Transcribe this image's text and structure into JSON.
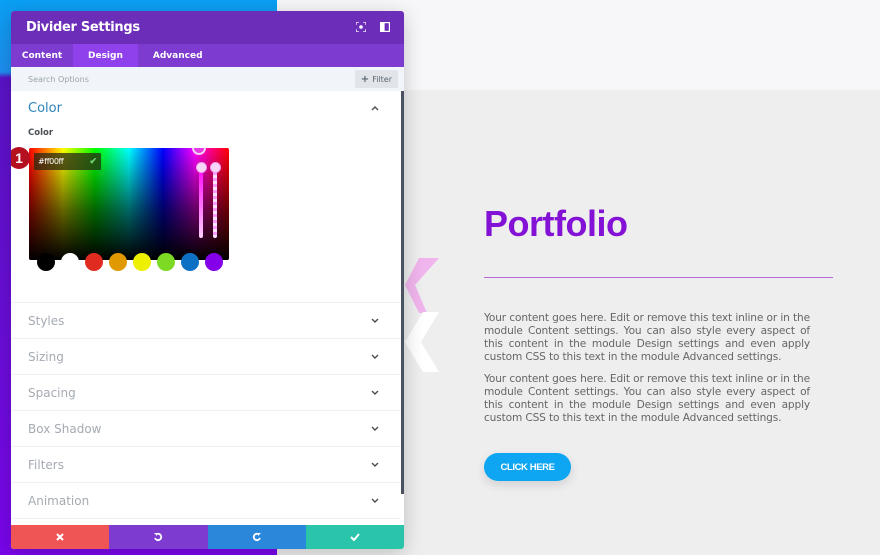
{
  "panel": {
    "title": "Divider Settings",
    "header_icons": [
      "focus-mode-icon",
      "split-view-icon"
    ],
    "tabs": [
      {
        "label": "Content",
        "active": false
      },
      {
        "label": "Design",
        "active": true
      },
      {
        "label": "Advanced",
        "active": false
      }
    ],
    "search": {
      "placeholder": "Search Options",
      "value": ""
    },
    "filter_label": "Filter",
    "open_section": {
      "title": "Color",
      "field_label": "Color",
      "hex_value": "#ff00ff",
      "step_badge": "1",
      "swatches": [
        "#000000",
        "#ffffff",
        "#e02b20",
        "#e09900",
        "#edf000",
        "#7cda24",
        "#0c71c3",
        "#8300e9"
      ]
    },
    "sections": [
      "Styles",
      "Sizing",
      "Spacing",
      "Box Shadow",
      "Filters",
      "Animation"
    ],
    "footer": {
      "buttons": [
        {
          "name": "discard-button",
          "icon": "close-icon",
          "color": "#ef5555"
        },
        {
          "name": "undo-button",
          "icon": "undo-icon",
          "color": "#7e3bd0"
        },
        {
          "name": "redo-button",
          "icon": "redo-icon",
          "color": "#2b87da"
        },
        {
          "name": "save-button",
          "icon": "check-icon",
          "color": "#29c4a9"
        }
      ]
    }
  },
  "page": {
    "heading": "Portfolio",
    "heading_color": "#8411d6",
    "paragraphs": [
      "Your content goes here. Edit or remove this text inline or in the module Content settings. You can also style every aspect of this content in the module Design settings and even apply custom CSS to this text in the module Advanced settings.",
      "Your content goes here. Edit or remove this text inline or in the module Content settings. You can also style every aspect of this content in the module Design settings and even apply custom CSS to this text in the module Advanced settings."
    ],
    "button_label": "CLICK HERE",
    "button_color": "#0ea5f2"
  }
}
